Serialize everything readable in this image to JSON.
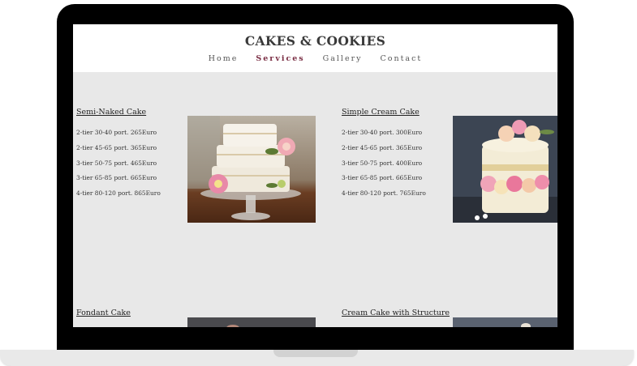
{
  "site": {
    "brand": "CAKES & COOKIES",
    "nav": [
      {
        "label": "Home",
        "active": false
      },
      {
        "label": "Services",
        "active": true
      },
      {
        "label": "Gallery",
        "active": false
      },
      {
        "label": "Contact",
        "active": false
      }
    ]
  },
  "cakes": [
    {
      "name": "Semi-Naked Cake",
      "prices": [
        "2-tier 30-40 port. 265Euro",
        "2-tier 45-65 port. 365Euro",
        "3-tier 50-75 port. 465Euro",
        "3-tier 65-85 port. 665Euro",
        "4-tier 80-120 port. 865Euro"
      ],
      "image": "semi-naked-cake-photo"
    },
    {
      "name": "Simple Cream Cake",
      "prices": [
        "2-tier 30-40 port. 300Euro",
        "2-tier 45-65 port. 365Euro",
        "3-tier 50-75 port. 400Euro",
        "3-tier 65-85 port. 665Euro",
        "4-tier 80-120 port. 765Euro"
      ],
      "image": "cream-cake-photo"
    },
    {
      "name": "Fondant Cake",
      "prices": [],
      "image": "fondant-cake-photo"
    },
    {
      "name": "Cream Cake with Structure",
      "prices": [],
      "image": "structured-cream-cake-photo"
    }
  ],
  "colors": {
    "accent": "#7b2f45",
    "content_bg": "#e8e8e8",
    "frame": "#000000"
  }
}
